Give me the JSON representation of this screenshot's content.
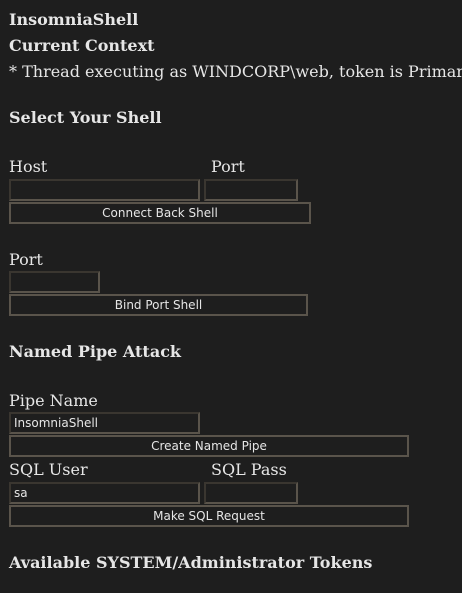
{
  "app_title": "InsomniaShell",
  "context": {
    "heading": "Current Context",
    "line": "* Thread executing as WINDCORP\\web, token is Primary"
  },
  "shell": {
    "heading": "Select Your Shell",
    "connect_back": {
      "host_label": "Host",
      "port_label": "Port",
      "host_value": "",
      "port_value": "",
      "button_label": "Connect Back Shell"
    },
    "bind_port": {
      "port_label": "Port",
      "port_value": "",
      "button_label": "Bind Port Shell"
    }
  },
  "named_pipe": {
    "heading": "Named Pipe Attack",
    "pipe_name_label": "Pipe Name",
    "pipe_name_value": "InsomniaShell",
    "create_button_label": "Create Named Pipe",
    "sql_user_label": "SQL User",
    "sql_user_value": "sa",
    "sql_pass_label": "SQL Pass",
    "sql_pass_value": "",
    "sql_button_label": "Make SQL Request"
  },
  "tokens": {
    "heading": "Available SYSTEM/Administrator Tokens"
  }
}
